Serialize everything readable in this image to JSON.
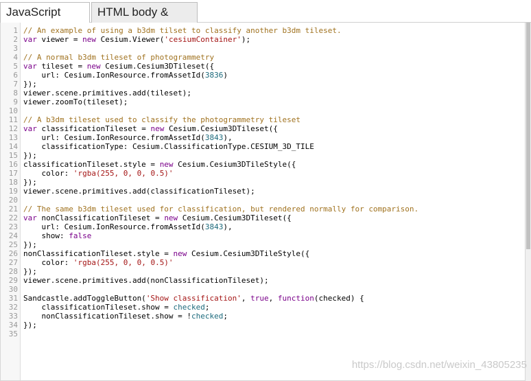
{
  "tabs": [
    {
      "label": "JavaScript code"
    },
    {
      "label": "HTML body & CSS"
    }
  ],
  "editor": {
    "lines": [
      {
        "n": "1",
        "parts": [
          {
            "t": "// An example of using a b3dm tilset to classify another b3dm tileset.",
            "c": "cm"
          }
        ]
      },
      {
        "n": "2",
        "parts": [
          {
            "t": "var",
            "c": "kw"
          },
          {
            "t": " viewer = "
          },
          {
            "t": "new",
            "c": "kw"
          },
          {
            "t": " Cesium.Viewer("
          },
          {
            "t": "'cesiumContainer'",
            "c": "st"
          },
          {
            "t": ");"
          }
        ]
      },
      {
        "n": "3",
        "parts": []
      },
      {
        "n": "4",
        "parts": [
          {
            "t": "// A normal b3dm tileset of photogrammetry",
            "c": "cm"
          }
        ]
      },
      {
        "n": "5",
        "parts": [
          {
            "t": "var",
            "c": "kw"
          },
          {
            "t": " tileset = "
          },
          {
            "t": "new",
            "c": "kw"
          },
          {
            "t": " Cesium.Cesium3DTileset({"
          }
        ]
      },
      {
        "n": "6",
        "parts": [
          {
            "t": "    url: Cesium.IonResource.fromAssetId("
          },
          {
            "t": "3836",
            "c": "nm"
          },
          {
            "t": ")"
          }
        ]
      },
      {
        "n": "7",
        "parts": [
          {
            "t": "});"
          }
        ]
      },
      {
        "n": "8",
        "parts": [
          {
            "t": "viewer.scene.primitives.add(tileset);"
          }
        ]
      },
      {
        "n": "9",
        "parts": [
          {
            "t": "viewer.zoomTo(tileset);"
          }
        ]
      },
      {
        "n": "10",
        "parts": []
      },
      {
        "n": "11",
        "parts": [
          {
            "t": "// A b3dm tileset used to classify the photogrammetry tileset",
            "c": "cm"
          }
        ]
      },
      {
        "n": "12",
        "parts": [
          {
            "t": "var",
            "c": "kw"
          },
          {
            "t": " classificationTileset = "
          },
          {
            "t": "new",
            "c": "kw"
          },
          {
            "t": " Cesium.Cesium3DTileset({"
          }
        ]
      },
      {
        "n": "13",
        "parts": [
          {
            "t": "    url: Cesium.IonResource.fromAssetId("
          },
          {
            "t": "3843",
            "c": "nm"
          },
          {
            "t": "),"
          }
        ]
      },
      {
        "n": "14",
        "parts": [
          {
            "t": "    classificationType: Cesium.ClassificationType.CESIUM_3D_TILE"
          }
        ]
      },
      {
        "n": "15",
        "parts": [
          {
            "t": "});"
          }
        ]
      },
      {
        "n": "16",
        "parts": [
          {
            "t": "classificationTileset.style = "
          },
          {
            "t": "new",
            "c": "kw"
          },
          {
            "t": " Cesium.Cesium3DTileStyle({"
          }
        ]
      },
      {
        "n": "17",
        "parts": [
          {
            "t": "    color: "
          },
          {
            "t": "'rgba(255, 0, 0, 0.5)'",
            "c": "st"
          }
        ]
      },
      {
        "n": "18",
        "parts": [
          {
            "t": "});"
          }
        ]
      },
      {
        "n": "19",
        "parts": [
          {
            "t": "viewer.scene.primitives.add(classificationTileset);"
          }
        ]
      },
      {
        "n": "20",
        "parts": []
      },
      {
        "n": "21",
        "parts": [
          {
            "t": "// The same b3dm tileset used for classification, but rendered normally for comparison.",
            "c": "cm"
          }
        ]
      },
      {
        "n": "22",
        "parts": [
          {
            "t": "var",
            "c": "kw"
          },
          {
            "t": " nonClassificationTileset = "
          },
          {
            "t": "new",
            "c": "kw"
          },
          {
            "t": " Cesium.Cesium3DTileset({"
          }
        ]
      },
      {
        "n": "23",
        "parts": [
          {
            "t": "    url: Cesium.IonResource.fromAssetId("
          },
          {
            "t": "3843",
            "c": "nm"
          },
          {
            "t": "),"
          }
        ]
      },
      {
        "n": "24",
        "parts": [
          {
            "t": "    show: "
          },
          {
            "t": "false",
            "c": "kw"
          }
        ]
      },
      {
        "n": "25",
        "parts": [
          {
            "t": "});"
          }
        ]
      },
      {
        "n": "26",
        "parts": [
          {
            "t": "nonClassificationTileset.style = "
          },
          {
            "t": "new",
            "c": "kw"
          },
          {
            "t": " Cesium.Cesium3DTileStyle({"
          }
        ]
      },
      {
        "n": "27",
        "parts": [
          {
            "t": "    color: "
          },
          {
            "t": "'rgba(255, 0, 0, 0.5)'",
            "c": "st"
          }
        ]
      },
      {
        "n": "28",
        "parts": [
          {
            "t": "});"
          }
        ]
      },
      {
        "n": "29",
        "parts": [
          {
            "t": "viewer.scene.primitives.add(nonClassificationTileset);"
          }
        ]
      },
      {
        "n": "30",
        "parts": []
      },
      {
        "n": "31",
        "parts": [
          {
            "t": "Sandcastle.addToggleButton("
          },
          {
            "t": "'Show classification'",
            "c": "st"
          },
          {
            "t": ", "
          },
          {
            "t": "true",
            "c": "kw"
          },
          {
            "t": ", "
          },
          {
            "t": "function",
            "c": "kw"
          },
          {
            "t": "(checked) {"
          }
        ]
      },
      {
        "n": "32",
        "parts": [
          {
            "t": "    classificationTileset.show = "
          },
          {
            "t": "checked",
            "c": "nm"
          },
          {
            "t": ";"
          }
        ]
      },
      {
        "n": "33",
        "parts": [
          {
            "t": "    nonClassificationTileset.show = !"
          },
          {
            "t": "checked",
            "c": "nm"
          },
          {
            "t": ";"
          }
        ]
      },
      {
        "n": "34",
        "parts": [
          {
            "t": "});"
          }
        ]
      },
      {
        "n": "35",
        "parts": []
      }
    ]
  },
  "watermark": "https://blog.csdn.net/weixin_43805235"
}
